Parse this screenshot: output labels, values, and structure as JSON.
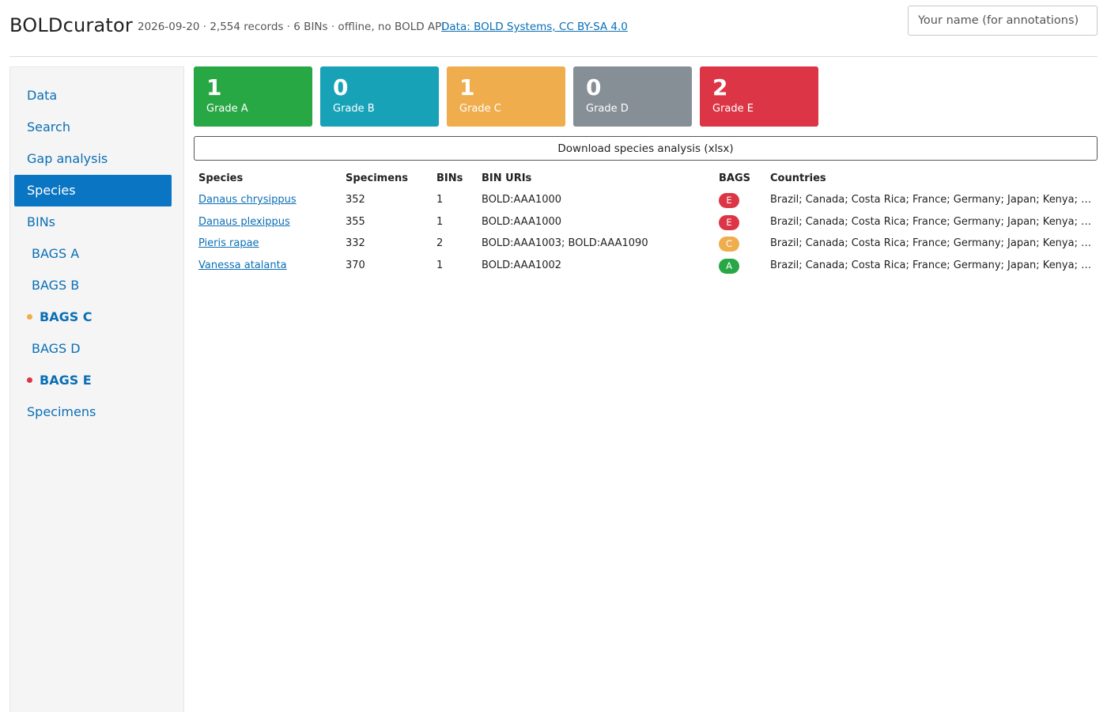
{
  "header": {
    "app_title": "BOLDcurator",
    "meta": "2026-09-20 · 2,554 records · 6 BINs · offline, no BOLD API",
    "data_link": "Data: BOLD Systems, CC BY-SA 4.0",
    "name_placeholder": "Your name (for annotations)"
  },
  "sidebar": {
    "items": [
      {
        "label": "Data"
      },
      {
        "label": "Search"
      },
      {
        "label": "Gap analysis"
      },
      {
        "label": "Species",
        "active": true
      },
      {
        "label": "BINs"
      },
      {
        "label": "BAGS A"
      },
      {
        "label": "BAGS B"
      },
      {
        "label": "BAGS C",
        "flag_color": "#f0ad4e"
      },
      {
        "label": "BAGS D"
      },
      {
        "label": "BAGS E",
        "flag_color": "#dc3545"
      },
      {
        "label": "Specimens"
      }
    ]
  },
  "grades": [
    {
      "count": "1",
      "label": "Grade A",
      "color": "#28a745"
    },
    {
      "count": "0",
      "label": "Grade B",
      "color": "#17a2b8"
    },
    {
      "count": "1",
      "label": "Grade C",
      "color": "#f0ad4e"
    },
    {
      "count": "0",
      "label": "Grade D",
      "color": "#868e96"
    },
    {
      "count": "2",
      "label": "Grade E",
      "color": "#dc3545"
    }
  ],
  "download_label": "Download species analysis (xlsx)",
  "table": {
    "headers": [
      "Species",
      "Specimens",
      "BINs",
      "BIN URIs",
      "BAGS",
      "Countries"
    ],
    "rows": [
      {
        "species": "Danaus chrysippus",
        "specimens": "352",
        "bins": "1",
        "bin_uris": "BOLD:AAA1000",
        "bags": "E",
        "bags_color": "#dc3545",
        "countries": "Brazil; Canada; Costa Rica; France; Germany; Japan; Kenya; Mexico"
      },
      {
        "species": "Danaus plexippus",
        "specimens": "355",
        "bins": "1",
        "bin_uris": "BOLD:AAA1000",
        "bags": "E",
        "bags_color": "#dc3545",
        "countries": "Brazil; Canada; Costa Rica; France; Germany; Japan; Kenya; Mexico"
      },
      {
        "species": "Pieris rapae",
        "specimens": "332",
        "bins": "2",
        "bin_uris": "BOLD:AAA1003; BOLD:AAA1090",
        "bags": "C",
        "bags_color": "#f0ad4e",
        "countries": "Brazil; Canada; Costa Rica; France; Germany; Japan; Kenya; Mexico"
      },
      {
        "species": "Vanessa atalanta",
        "specimens": "370",
        "bins": "1",
        "bin_uris": "BOLD:AAA1002",
        "bags": "A",
        "bags_color": "#28a745",
        "countries": "Brazil; Canada; Costa Rica; France; Germany; Japan; Kenya; Mexico"
      }
    ]
  }
}
